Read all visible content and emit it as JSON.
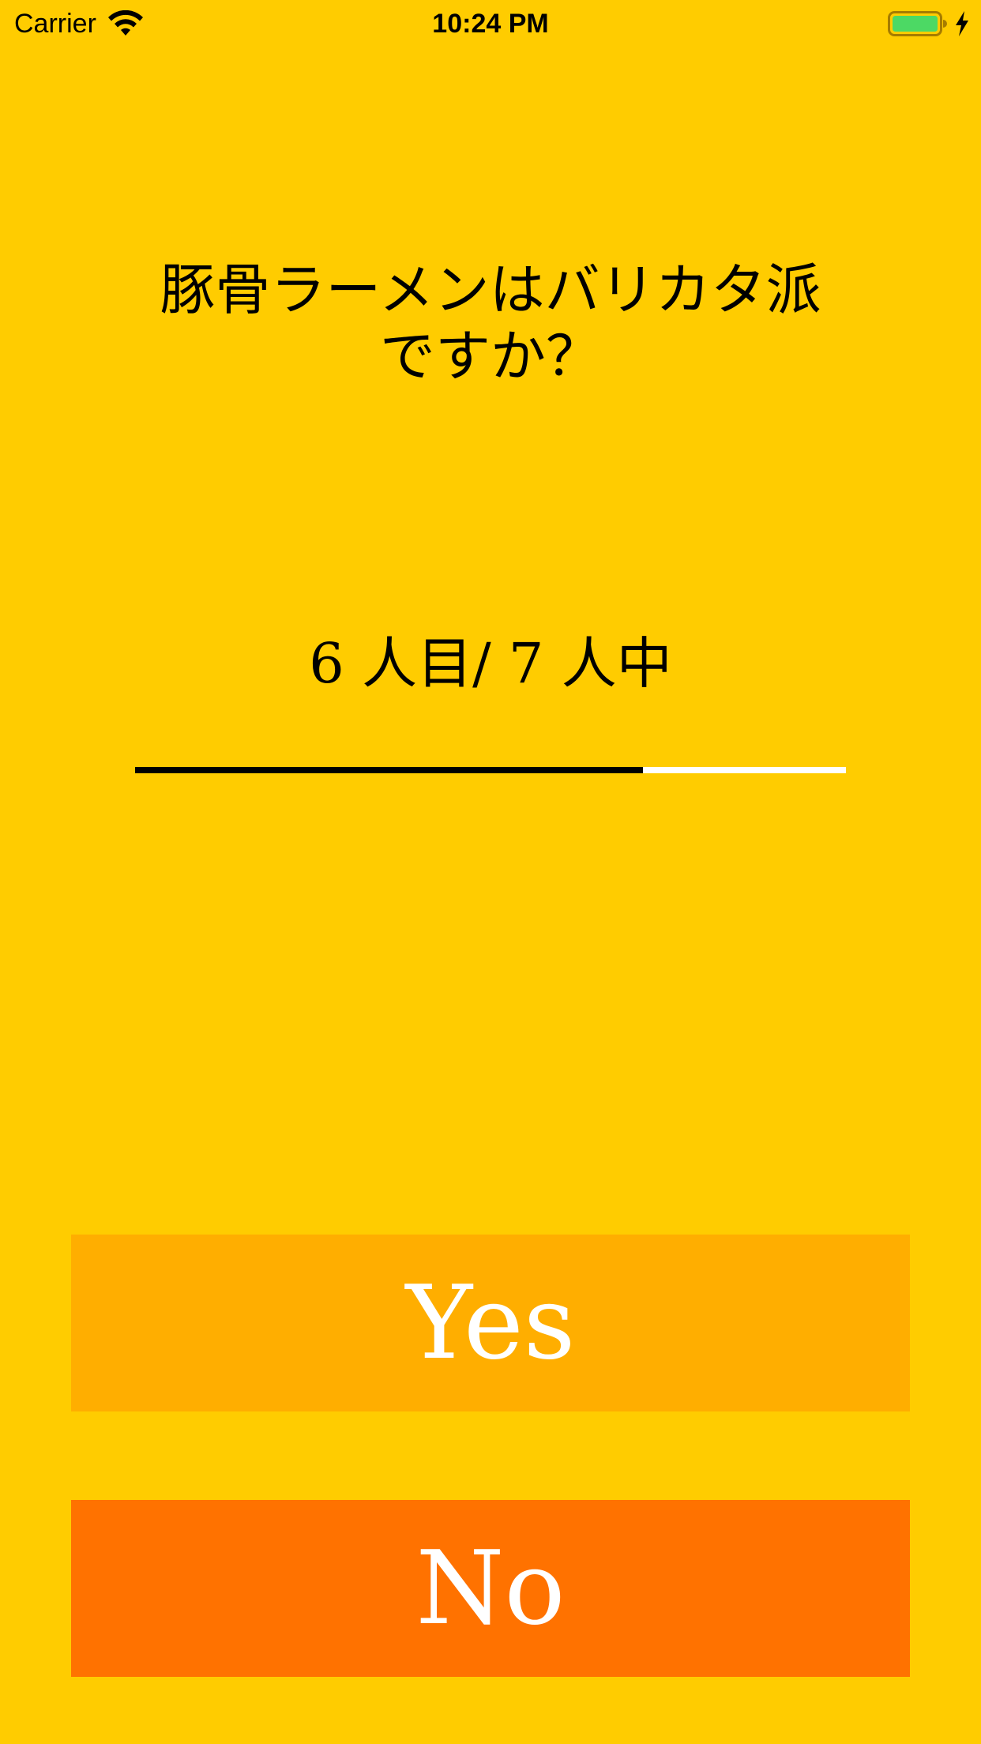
{
  "status_bar": {
    "carrier": "Carrier",
    "time": "10:24 PM",
    "wifi_icon": "wifi-icon",
    "battery_icon": "battery-icon",
    "charging_icon": "charging-bolt-icon",
    "battery_fill_color": "#4CD964"
  },
  "question": {
    "line1": "豚骨ラーメンはバリカタ派",
    "line2": "ですか？"
  },
  "progress": {
    "label": "6 人目/ 7 人中",
    "current": 6,
    "total": 7,
    "fraction": 0.7143,
    "fill_color": "#000000",
    "track_color": "#FFFFFF"
  },
  "buttons": {
    "yes_label": "Yes",
    "no_label": "No",
    "yes_color": "#FFAE00",
    "no_color": "#FF7200"
  },
  "colors": {
    "background": "#FFCC00"
  }
}
